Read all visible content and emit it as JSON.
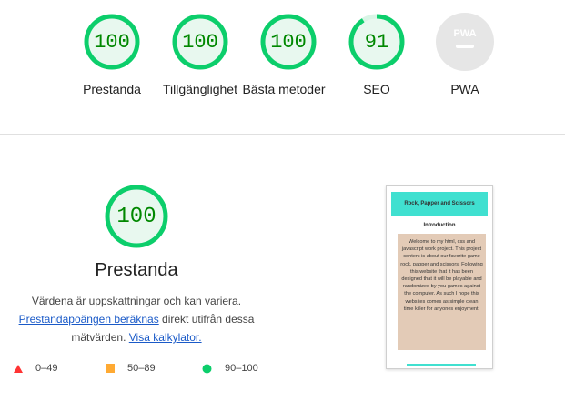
{
  "top_scores": [
    {
      "value": "100",
      "label": "Prestanda",
      "color": "#0cce6b",
      "fraction": 1.0
    },
    {
      "value": "100",
      "label": "Tillgänglighet",
      "color": "#0cce6b",
      "fraction": 1.0
    },
    {
      "value": "100",
      "label": "Bästa metoder",
      "color": "#0cce6b",
      "fraction": 1.0
    },
    {
      "value": "91",
      "label": "SEO",
      "color": "#0cce6b",
      "fraction": 0.91
    },
    {
      "value": "",
      "label": "PWA",
      "badge_text": "PWA",
      "color": "#cccccc"
    }
  ],
  "main": {
    "score": "100",
    "title": "Prestanda",
    "desc_line1": "Värdena är uppskattningar och kan variera.",
    "calc_link": "Prestandapoängen beräknas",
    "desc_mid": " direkt utifrån dessa",
    "desc_line3_prefix": "mätvärden. ",
    "calculator_link": "Visa kalkylator."
  },
  "legend": [
    {
      "range": "0–49",
      "shape": "triangle",
      "color": "#ff3333"
    },
    {
      "range": "50–89",
      "shape": "square",
      "color": "#ffaa33"
    },
    {
      "range": "90–100",
      "shape": "circle",
      "color": "#0cce6b"
    }
  ],
  "screenshot": {
    "header": "Rock, Papper and Scissors",
    "heading": "Introduction",
    "body": "Welcome to my html, css and javascript work project. This project content is about our favorite game rock, papper and scissors. Following this website that it has been designed that it will be playable and randomized by you games against the computer. As such I hope this websites comes as simple clean time killer for anyones enjoyment."
  }
}
